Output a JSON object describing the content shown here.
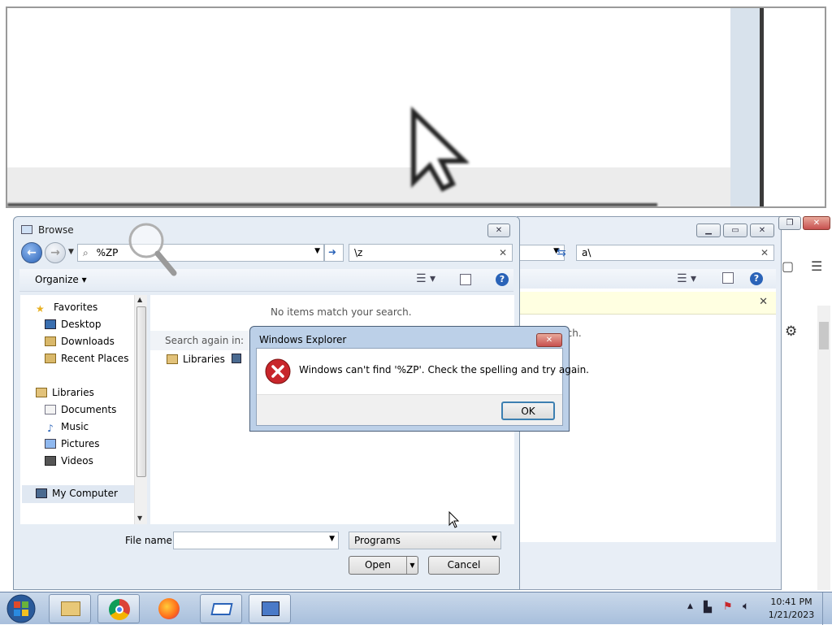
{
  "browse": {
    "title": "Browse",
    "address_value": "%ZP",
    "search_value": "\\z",
    "organize_label": "Organize",
    "no_items": "No items match your search.",
    "search_again": "Search again in:",
    "search_again_libraries": "Libraries",
    "nav": {
      "favorites": "Favorites",
      "desktop": "Desktop",
      "downloads": "Downloads",
      "recent": "Recent Places",
      "libraries": "Libraries",
      "documents": "Documents",
      "music": "Music",
      "pictures": "Pictures",
      "videos": "Videos",
      "my_computer": "My Computer"
    },
    "file_name_label": "File name:",
    "file_name_value": "",
    "file_type": "Programs",
    "open_label": "Open",
    "cancel_label": "Cancel"
  },
  "bg_explorer": {
    "search_value": "a\\",
    "content_text": "rch."
  },
  "error_dialog": {
    "title": "Windows Explorer",
    "message": "Windows can't find '%ZP'.  Check the spelling and try again.",
    "ok_label": "OK"
  },
  "tray": {
    "time": "10:41 PM",
    "date": "1/21/2023"
  },
  "taskbar_items": [
    "start-orb",
    "file-explorer",
    "chrome",
    "firefox",
    "run-dialog",
    "network-app"
  ],
  "colors": {
    "error_red": "#c8262b",
    "accent_blue": "#2a63b8",
    "taskbar": "#b9cde4"
  }
}
